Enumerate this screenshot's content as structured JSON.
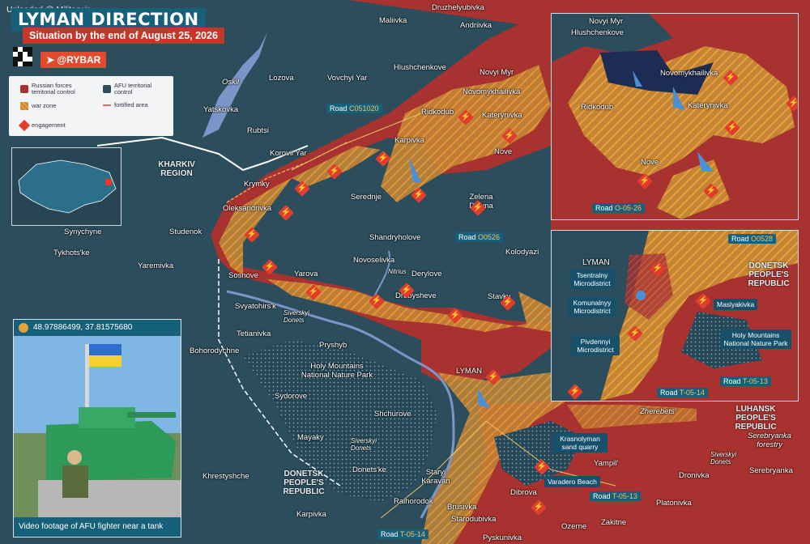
{
  "watermark": "Uploaded @ Military.ir",
  "header": {
    "title": "LYMAN DIRECTION",
    "subtitle": "Situation by the end of August 25, 2026"
  },
  "brand": {
    "handle": "@RYBAR",
    "icon": "telegram-icon"
  },
  "legend": {
    "russian": "Russian forces territorial control",
    "afu": "AFU territorial control",
    "war_zone": "war zone",
    "fortified": "fortified area",
    "engagement": "engagement"
  },
  "colors": {
    "russian": "#a8322f",
    "afu": "#2c4d5c",
    "war_zone": "#e8a13c",
    "engagement": "#e23c2f",
    "brand": "#e24b2d",
    "accent": "#17607a"
  },
  "photo": {
    "coords": "48.97886499, 37.81575680",
    "caption": "Video footage of AFU fighter near a tank"
  },
  "places": {
    "maliivka": "Maliivka",
    "druzhelyubivka": "Druzhelyubivka",
    "andriivka": "Andriivka",
    "hlushchenkove": "Hlushchenkove",
    "novyi_myr": "Novyi Myr",
    "novomykhailivka": "Novomykhailivka",
    "lozova": "Lozova",
    "vovchyi_yar": "Vovchyi Yar",
    "oskil": "Oskil",
    "yatskovka": "Yatskovka",
    "rubtsi": "Rubtsi",
    "korovii_yar": "Korovii Yar",
    "ridkodub": "Ridkodub",
    "kupiansk": "Katerynіvka",
    "karpivka": "Karpivka",
    "nove": "Nove",
    "krymky": "Krymky",
    "kharkiv_region": "KHARKIV REGION",
    "serednje": "Serednje",
    "zelena_dolyna": "Zelena Dolyna",
    "oleksandrivka": "Oleksandrivka",
    "synychyne": "Synychyne",
    "studenok": "Studenok",
    "shandryholove": "Shandryholove",
    "kolodyazi": "Kolodyazi",
    "tykhotske": "Tykhots'ke",
    "yaremivka": "Yaremivka",
    "novoselivka": "Novoselivka",
    "nitrius": "Nitrius",
    "sosnove": "Sosnove",
    "yarova": "Yarova",
    "derylove": "Derylove",
    "drobysheve": "Drobysheve",
    "stavky": "Stavky",
    "svyatohirsk": "Svyatohirs'k",
    "siverskyi_donets": "Siverskyi Donets",
    "tetianivka": "Tetianivka",
    "pryshyb": "Pryshyb",
    "bohorodychne": "Bohorodychne",
    "holy_mountains": "Holy Mountains National Nature Park",
    "lyman": "LYMAN",
    "sydorove": "Sydorove",
    "shchurove": "Shchurove",
    "mayaky": "Mayaky",
    "siverskyi_donets2": "Siverskyi Donets",
    "donetske": "Donets'ke",
    "khrestyshche": "Khrestyshche",
    "dpr": "DONETSK PEOPLE'S REPUBLIC",
    "staryi_karavan": "Staryi Karavan",
    "raihorodok": "Raihorodok",
    "karpivka2": "Karpivka",
    "brusivka": "Brusivka",
    "starodubivka": "Starodubivka",
    "pyskunivka": "Pyskunivka",
    "dibrova": "Dibrova",
    "ozerne": "Ozerne",
    "zakitne": "Zakitne",
    "yampil": "Yampil'",
    "dronivka": "Dronivka",
    "platonivka": "Platonivka",
    "serebryanka": "Serebryanka",
    "siverskyi_donets3": "Siverskyi Donets",
    "zherebets": "Zherebets'",
    "lpr": "LUHANSK PEOPLE'S REPUBLIC",
    "serebryanka_forestry": "Serebryanka forestry",
    "krasnolyman": "Krasnolyman sand quarry",
    "varadero": "Varadero Beach"
  },
  "roads": {
    "c051020": {
      "prefix": "Road",
      "code": "C051020"
    },
    "o0526": {
      "prefix": "Road",
      "code": "O0526"
    },
    "t0514_a": {
      "prefix": "Road",
      "code": "T-05-14"
    },
    "t0513_a": {
      "prefix": "Road",
      "code": "T-05-13"
    },
    "t0514_b": {
      "prefix": "Road",
      "code": "T-05-14"
    }
  },
  "inset1": {
    "hlushchenkove": "Hlushchenkove",
    "novyi_myr": "Novyi Myr",
    "novomykhailivka": "Novomykhailivka",
    "ridkodub": "Ridkodub",
    "katerynivka": "Katerynivka",
    "nove": "Nove",
    "road": {
      "prefix": "Road",
      "code": "O-05-26"
    }
  },
  "inset2": {
    "lyman": "LYMAN",
    "tsentralny": "Tsentralny Microdistrict",
    "komunalnyy": "Komunalnyy Microdistrict",
    "pivdennyi": "Pivdennyi Microdistrict",
    "maslyakivka": "Maslyakivka",
    "holy_mountains": "Holy Mountains National Nature Park",
    "dpr": "DONETSK PEOPLE'S REPUBLIC",
    "road_o0528": {
      "prefix": "Road",
      "code": "O0528"
    },
    "road_t0513": {
      "prefix": "Road",
      "code": "T-05-13"
    },
    "road_t0514": {
      "prefix": "Road",
      "code": "T-05-14"
    }
  }
}
